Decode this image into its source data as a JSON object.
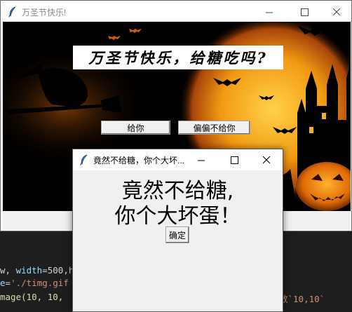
{
  "main_window": {
    "title": "万圣节快乐!",
    "banner_text": "万圣节快乐，给糖吃吗?",
    "give_button": "给你",
    "refuse_button": "偏偏不给你"
  },
  "dialog": {
    "title": "竟然不给糖，你个大坏...",
    "message_line1": "竟然不给糖,",
    "message_line2": "你个大坏蛋！",
    "ok_button": "确定"
  },
  "editor": {
    "line1_a": "w, ",
    "line1_b": "width",
    "line1_c": "=500,",
    "line1_d": "he",
    "line2_a": "e",
    "line2_b": "=",
    "line2_c": "'./timg.gif",
    "line3_a": "mage(10, 10, ",
    "line3_b": "数`10,10`"
  },
  "colors": {
    "moon": "#f7b21b",
    "canvas_bg": "#000000",
    "dialog_bg": "#f0f0f0"
  }
}
